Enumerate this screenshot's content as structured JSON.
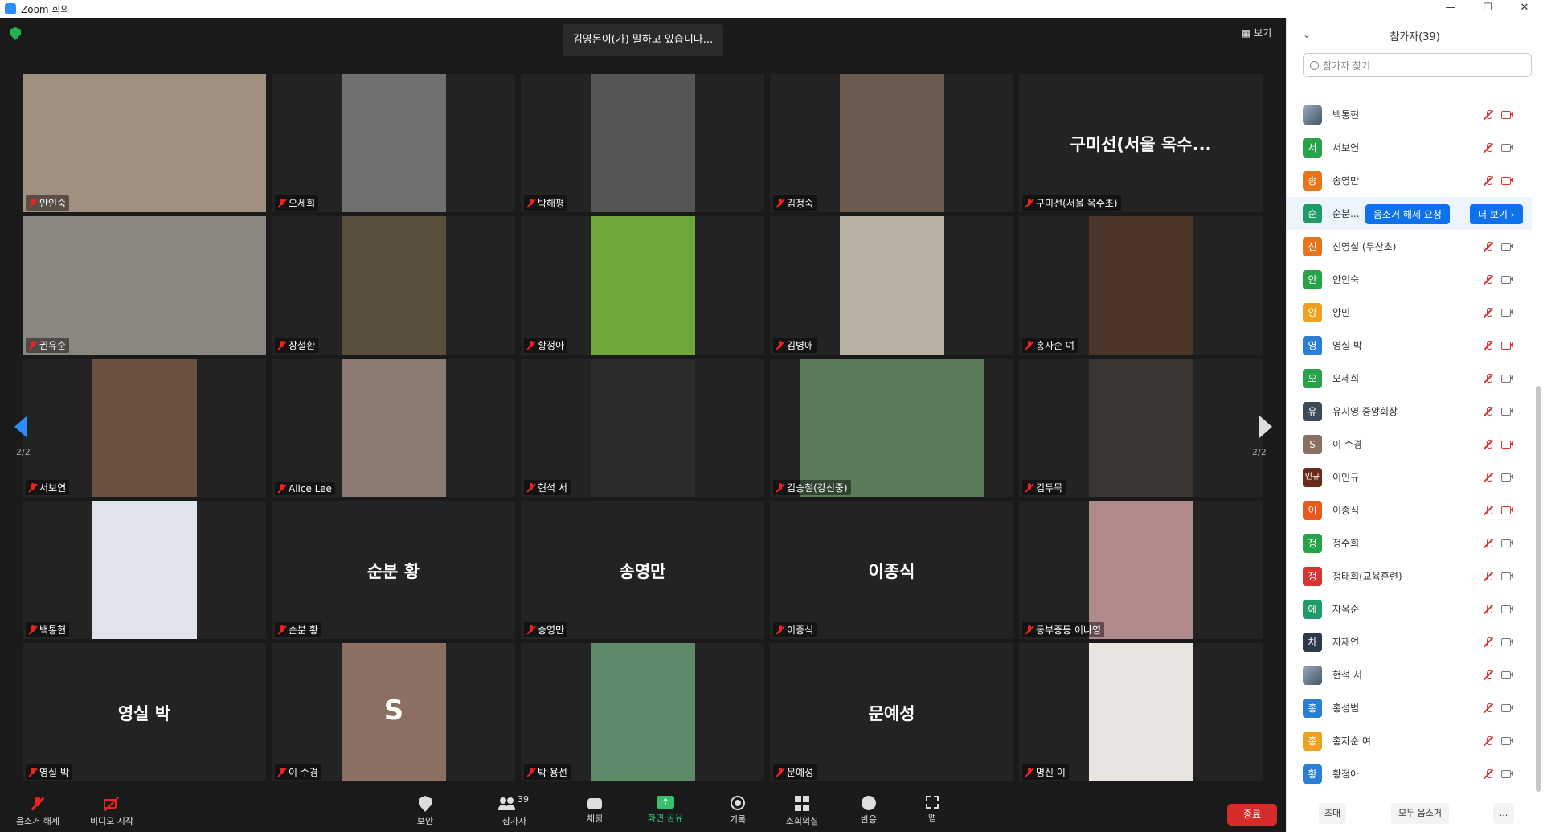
{
  "window": {
    "title": "Zoom 회의",
    "controls": [
      "—",
      "☐",
      "✕"
    ]
  },
  "meeting": {
    "speaking": "김영돈이(가) 말하고 있습니다...",
    "view_label": "보기",
    "page_indicator_left": "2/2",
    "page_indicator_right": "2/2"
  },
  "tiles": [
    {
      "name": "안인숙",
      "big": "",
      "video": "#a09080"
    },
    {
      "name": "오세희",
      "big": "",
      "video": "#707070"
    },
    {
      "name": "박해평",
      "big": "",
      "video": "#555555"
    },
    {
      "name": "김정숙",
      "big": "",
      "video": "#6b5a4e"
    },
    {
      "name": "구미선(서울 옥수초)",
      "big": "구미선(서울 옥수...",
      "video": ""
    },
    {
      "name": "권유순",
      "big": "",
      "video": "#8a8680"
    },
    {
      "name": "장철환",
      "big": "",
      "video": "#5a4e3d"
    },
    {
      "name": "황정아",
      "big": "",
      "video": "#6fa63a"
    },
    {
      "name": "김병애",
      "big": "",
      "video": "#b8b0a0"
    },
    {
      "name": "홍자순 여",
      "big": "",
      "video": "#4a3528"
    },
    {
      "name": "서보연",
      "big": "",
      "video": "#6a5040"
    },
    {
      "name": "Alice Lee",
      "big": "",
      "video": "#8a7a70"
    },
    {
      "name": "현석 서",
      "big": "",
      "video": "#2a2a2a"
    },
    {
      "name": "김승철(강신중)",
      "big": "",
      "video": "#5a7a5a"
    },
    {
      "name": "김두묵",
      "big": "",
      "video": "#3a3530"
    },
    {
      "name": "백통현",
      "big": "",
      "video": "#dfe4ea"
    },
    {
      "name": "순분 황",
      "big": "순분 황",
      "video": ""
    },
    {
      "name": "송영만",
      "big": "송영만",
      "video": ""
    },
    {
      "name": "이종식",
      "big": "이종식",
      "video": ""
    },
    {
      "name": "동부중등 이나영",
      "big": "",
      "video": "#b08a8a"
    },
    {
      "name": "영실 박",
      "big": "영실 박",
      "video": ""
    },
    {
      "name": "이 수경",
      "big": "",
      "video": "#8b6f63"
    },
    {
      "name": "박 용선",
      "big": "",
      "video": "#5f8a6a"
    },
    {
      "name": "문예성",
      "big": "문예성",
      "video": ""
    },
    {
      "name": "명신 이",
      "big": "",
      "video": "#e8e4e0"
    }
  ],
  "tile_s_letter": "S",
  "toolbar": {
    "unmute": "음소거 해제",
    "video_start": "비디오 시작",
    "security": "보안",
    "participants": "참가자",
    "participants_count": "39",
    "chat": "채팅",
    "share": "화면 공유",
    "record": "기록",
    "breakout": "소회의실",
    "reactions": "반응",
    "apps": "앱",
    "end": "종료"
  },
  "panel": {
    "title": "참가자(39)",
    "search_placeholder": "참가자 찾기",
    "unmute_request": "음소거 해제 요청",
    "more": "더 보기 ›",
    "footer_invite": "초대",
    "footer_mute_all": "모두 음소거",
    "footer_more": "...",
    "participants": [
      {
        "name": "백통현",
        "letter": "",
        "color": "#f0f0f0",
        "img": true,
        "cam_off": true
      },
      {
        "name": "서보연",
        "letter": "서",
        "color": "#27a34a",
        "img": false,
        "cam_off": false
      },
      {
        "name": "송영만",
        "letter": "송",
        "color": "#e8741e",
        "img": false,
        "cam_off": true
      },
      {
        "name": "순분...",
        "letter": "순",
        "color": "#1f9b6a",
        "img": false,
        "cam_off": false
      },
      {
        "name": "신영실 (두산초)",
        "letter": "신",
        "color": "#e8741e",
        "img": false,
        "cam_off": false
      },
      {
        "name": "안인숙",
        "letter": "안",
        "color": "#27a34a",
        "img": false,
        "cam_off": false
      },
      {
        "name": "양민",
        "letter": "양",
        "color": "#f0a020",
        "img": false,
        "cam_off": false
      },
      {
        "name": "영실 박",
        "letter": "영",
        "color": "#2a7fd4",
        "img": false,
        "cam_off": true
      },
      {
        "name": "오세희",
        "letter": "오",
        "color": "#27a34a",
        "img": false,
        "cam_off": false
      },
      {
        "name": "유지영 중앙회장",
        "letter": "유",
        "color": "#3c4a5a",
        "img": false,
        "cam_off": false
      },
      {
        "name": "이 수경",
        "letter": "S",
        "color": "#8b6f63",
        "img": false,
        "cam_off": true
      },
      {
        "name": "이인규",
        "letter": "인규",
        "color": "#6b2b1a",
        "img": false,
        "cam_off": false
      },
      {
        "name": "이종식",
        "letter": "이",
        "color": "#e85a1e",
        "img": false,
        "cam_off": true
      },
      {
        "name": "정수희",
        "letter": "정",
        "color": "#27a34a",
        "img": false,
        "cam_off": false
      },
      {
        "name": "정태희(교육훈련)",
        "letter": "정",
        "color": "#d63333",
        "img": false,
        "cam_off": false
      },
      {
        "name": "자옥순",
        "letter": "에",
        "color": "#1f9b6a",
        "img": false,
        "cam_off": false
      },
      {
        "name": "자재연",
        "letter": "차",
        "color": "#2a3a4a",
        "img": false,
        "cam_off": false
      },
      {
        "name": "현석 서",
        "letter": "",
        "color": "#456",
        "img": true,
        "cam_off": false
      },
      {
        "name": "홍성범",
        "letter": "홍",
        "color": "#2a7fd4",
        "img": false,
        "cam_off": false
      },
      {
        "name": "홍자순 여",
        "letter": "홍",
        "color": "#f0a020",
        "img": false,
        "cam_off": false
      },
      {
        "name": "황정아",
        "letter": "황",
        "color": "#2a7fd4",
        "img": false,
        "cam_off": false
      }
    ]
  }
}
